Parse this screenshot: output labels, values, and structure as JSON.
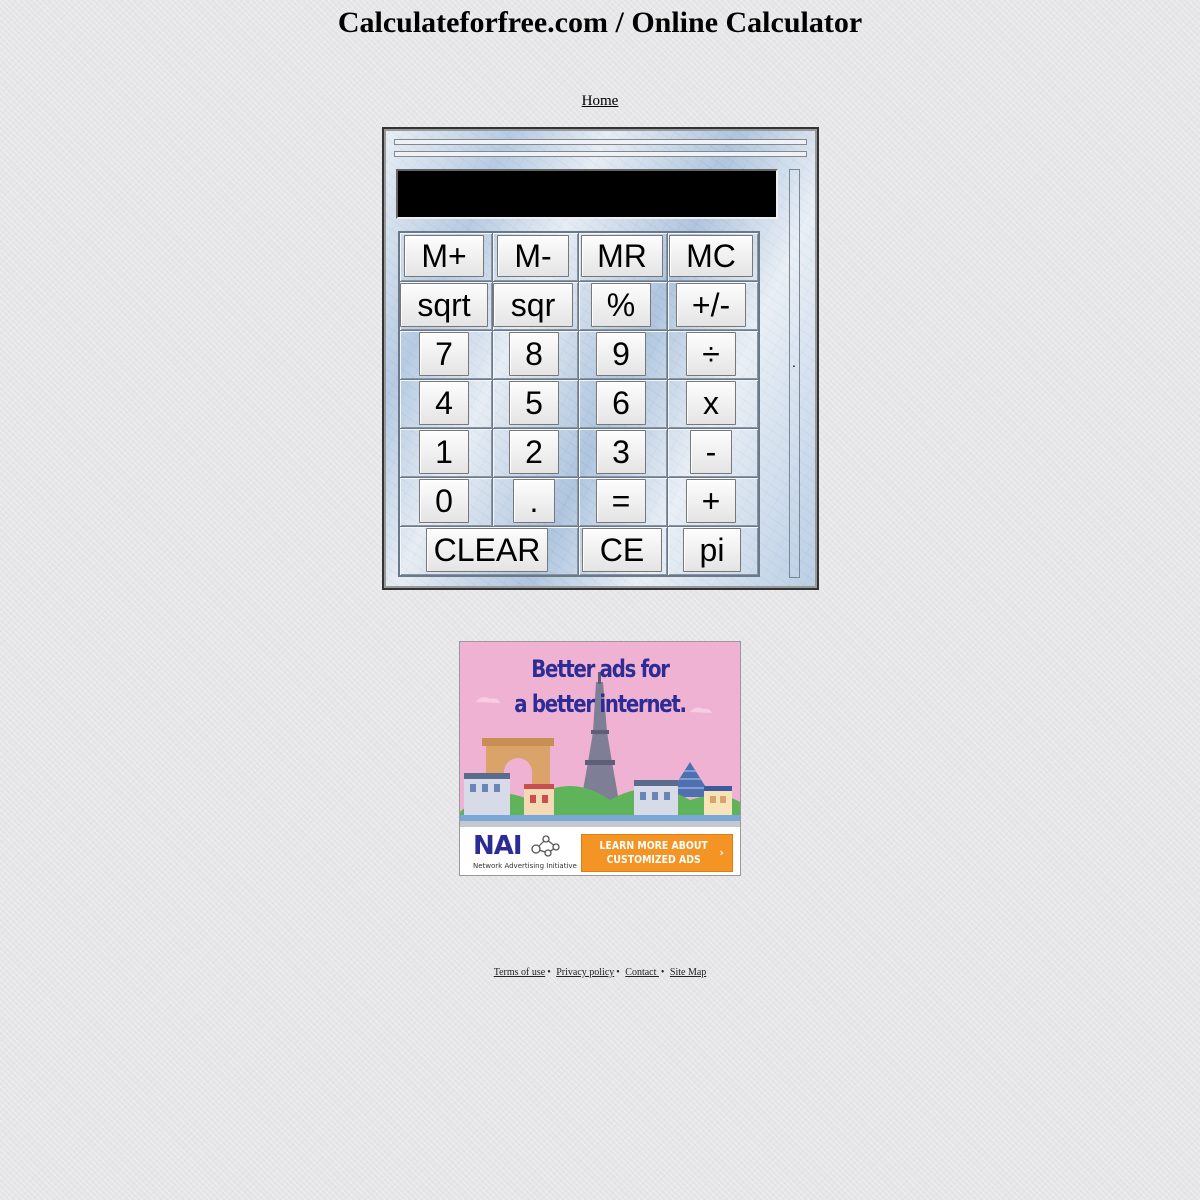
{
  "header": {
    "title": "Calculateforfree.com / Online Calculator",
    "home_link": "Home"
  },
  "calculator": {
    "display_value": "",
    "side_marker": ".",
    "rows": [
      [
        "M+",
        "M-",
        "MR",
        "MC"
      ],
      [
        "sqrt",
        "sqr",
        "%",
        "+/-"
      ],
      [
        "7",
        "8",
        "9",
        "÷"
      ],
      [
        "4",
        "5",
        "6",
        "x"
      ],
      [
        "1",
        "2",
        "3",
        "-"
      ],
      [
        "0",
        ".",
        "=",
        "+"
      ],
      [
        "CLEAR",
        "CE",
        "pi"
      ]
    ]
  },
  "ad": {
    "headline_line1": "Better ads for",
    "headline_line2": "a better internet.",
    "logo": "NAI",
    "logo_subtitle": "Network Advertising Initiative",
    "cta": "LEARN MORE ABOUT\nCUSTOMIZED ADS",
    "cta_arrow": "›",
    "icon": "network-nodes-icon"
  },
  "footer": {
    "links": [
      "Terms of use",
      "Privacy policy",
      "Contact ",
      "Site Map"
    ],
    "separator": "•"
  }
}
